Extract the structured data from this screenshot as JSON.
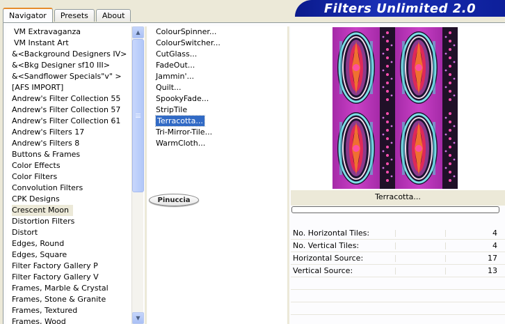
{
  "tabs": [
    {
      "label": "Navigator",
      "active": true
    },
    {
      "label": "Presets",
      "active": false
    },
    {
      "label": "About",
      "active": false
    }
  ],
  "banner": {
    "title": "Filters Unlimited 2.0"
  },
  "categories": [
    "VM Extravaganza",
    "VM Instant Art",
    "&<Background Designers IV>",
    "&<Bkg Designer sf10 III>",
    "&<Sandflower Specials\"v\" >",
    "[AFS IMPORT]",
    "Andrew's Filter Collection 55",
    "Andrew's Filter Collection 57",
    "Andrew's Filter Collection 61",
    "Andrew's Filters 17",
    "Andrew's Filters 8",
    "Buttons & Frames",
    "Color Effects",
    "Color Filters",
    "Convolution Filters",
    "CPK Designs",
    "Crescent Moon",
    "Distortion Filters",
    "Distort",
    "Edges, Round",
    "Edges, Square",
    "Filter Factory Gallery P",
    "Filter Factory Gallery V",
    "Frames, Marble & Crystal",
    "Frames, Stone & Granite",
    "Frames, Textured",
    "Frames, Wood"
  ],
  "selected_category": "Crescent Moon",
  "filters": [
    "ColourSpinner...",
    "ColourSwitcher...",
    "CutGlass...",
    "FadeOut...",
    "Jammin'...",
    "Quilt...",
    "SpookyFade...",
    "StripTile",
    "Terracotta...",
    "Tri-Mirror-Tile...",
    "WarmCloth..."
  ],
  "selected_filter": "Terracotta...",
  "signature": "Pinuccia",
  "preview": {
    "filter_name": "Terracotta...",
    "progress": 1.0,
    "progress_color": "#3a8a3a"
  },
  "params": [
    {
      "label": "No. Horizontal Tiles:",
      "value": "4"
    },
    {
      "label": "No. Vertical Tiles:",
      "value": "4"
    },
    {
      "label": "Horizontal Source:",
      "value": "17"
    },
    {
      "label": "Vertical Source:",
      "value": "13"
    }
  ],
  "colors": {
    "selection": "#316ac5",
    "banner": "#0d1f9a",
    "tab_accent": "#e68b2c"
  }
}
